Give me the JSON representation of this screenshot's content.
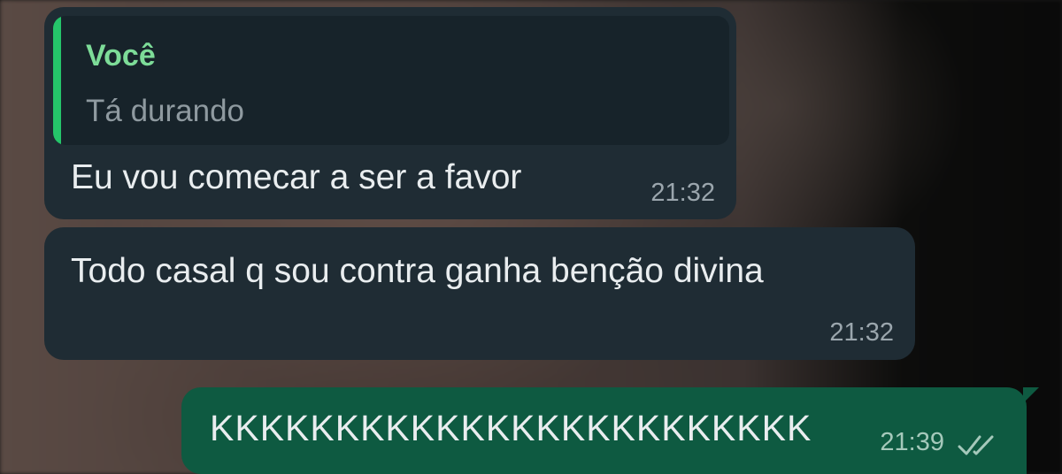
{
  "messages": [
    {
      "direction": "incoming",
      "reply": {
        "author": "Você",
        "text": "Tá durando"
      },
      "text": "Eu vou comecar a ser a favor",
      "time": "21:32"
    },
    {
      "direction": "incoming",
      "text": "Todo casal q sou contra ganha benção divina",
      "time": "21:32"
    },
    {
      "direction": "outgoing",
      "text": "KKKKKKKKKKKKKKKKKKKKKKKK",
      "time": "21:39",
      "status_icon": "double-check-icon"
    }
  ],
  "colors": {
    "incoming_bubble": "#1f2c34",
    "outgoing_bubble": "#0e5a41",
    "reply_accent": "#25c56a",
    "reply_author": "#7ddc98"
  }
}
